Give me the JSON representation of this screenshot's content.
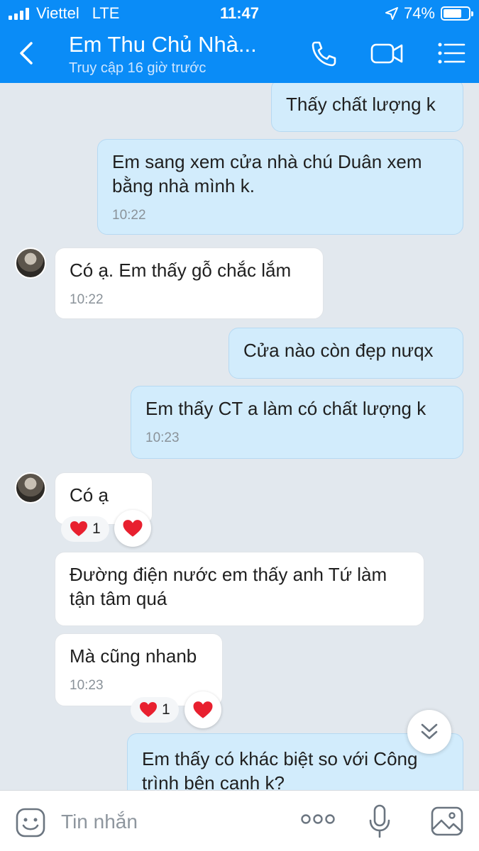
{
  "status_bar": {
    "carrier": "Viettel",
    "network": "LTE",
    "time": "11:47",
    "battery": "74%",
    "battery_level": 0.74
  },
  "header": {
    "title": "Em Thu Chủ Nhà...",
    "subtitle": "Truy cập 16 giờ trước"
  },
  "messages": [
    {
      "side": "out",
      "text": "Thấy chất lượng k"
    },
    {
      "side": "out",
      "text": "Em sang xem cửa nhà chú Duân xem bằng nhà mình k.",
      "time": "10:22"
    },
    {
      "side": "in",
      "text": "Có ạ. Em thấy gỗ chắc lắm",
      "time": "10:22"
    },
    {
      "side": "out",
      "text": "Cửa nào còn đẹp nưqx"
    },
    {
      "side": "out",
      "text": "Em thấy CT a làm có chất lượng k",
      "time": "10:23"
    },
    {
      "side": "in",
      "text": "Có ạ",
      "reaction_count": "1"
    },
    {
      "side": "in",
      "text": "Đường điện nước em thấy anh Tứ làm tận tâm quá"
    },
    {
      "side": "in",
      "text": "Mà cũng nhanb",
      "time": "10:23",
      "reaction_count": "1"
    },
    {
      "side": "out",
      "text": "Em thấy có khác biệt so với Công trình bên canh k?"
    }
  ],
  "input": {
    "placeholder": "Tin nhắn"
  },
  "colors": {
    "header": "#0a8cf7",
    "outgoing_bubble": "#d2ecfc",
    "incoming_bubble": "#ffffff",
    "background": "#e2e8ee",
    "heart": "#e8202f"
  },
  "icons": [
    "back-chevron-icon",
    "phone-icon",
    "video-call-icon",
    "menu-icon",
    "heart-icon",
    "scroll-down-icon",
    "sticker-icon",
    "more-icon",
    "microphone-icon",
    "image-icon"
  ]
}
